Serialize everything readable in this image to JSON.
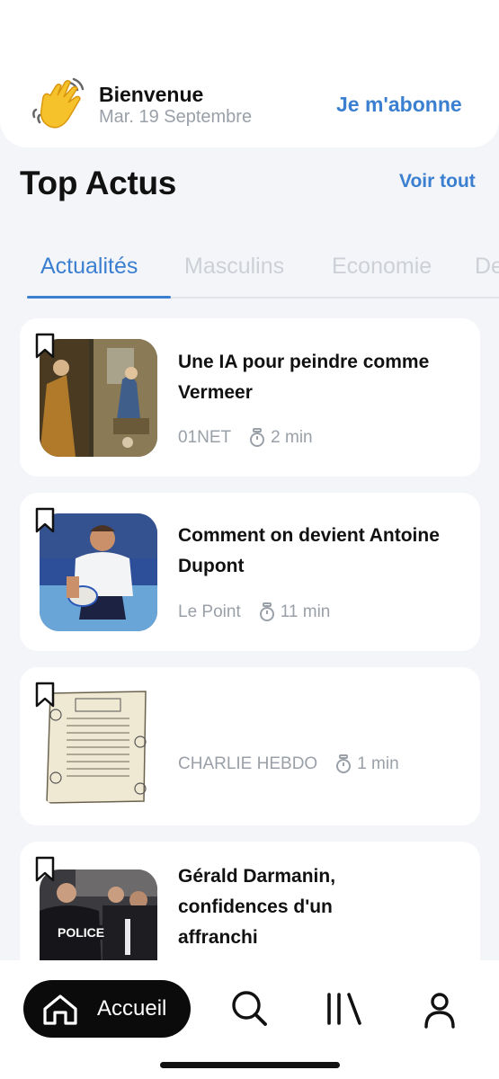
{
  "header": {
    "welcome_title": "Bienvenue",
    "date": "Mar. 19 Septembre",
    "subscribe_label": "Je m'abonne",
    "wave_icon": "waving-hand-emoji"
  },
  "section": {
    "title": "Top Actus",
    "see_all": "Voir tout"
  },
  "tabs": [
    {
      "label": "Actualités",
      "active": true
    },
    {
      "label": "Masculins",
      "active": false
    },
    {
      "label": "Economie",
      "active": false
    },
    {
      "label": "De",
      "active": false
    }
  ],
  "articles": [
    {
      "title": "Une IA pour peindre comme Vermeer",
      "source": "01NET",
      "read_time": "2 min",
      "image": "vermeer-painting"
    },
    {
      "title": "Comment on devient Antoine Dupont",
      "source": "Le Point",
      "read_time": "11 min",
      "image": "rugby-player"
    },
    {
      "title": "",
      "source": "CHARLIE HEBDO",
      "read_time": "1 min",
      "image": "cartoon-page"
    },
    {
      "title": "Gérald Darmanin, confidences d'un affranchi",
      "source": "",
      "read_time": "",
      "image": "police-crowd"
    }
  ],
  "nav": {
    "home_label": "Accueil",
    "items": [
      "home-icon",
      "search-icon",
      "library-icon",
      "profile-icon"
    ]
  },
  "colors": {
    "accent": "#3b7fd1",
    "background": "#f4f5f8",
    "muted": "#9aa0a8"
  }
}
